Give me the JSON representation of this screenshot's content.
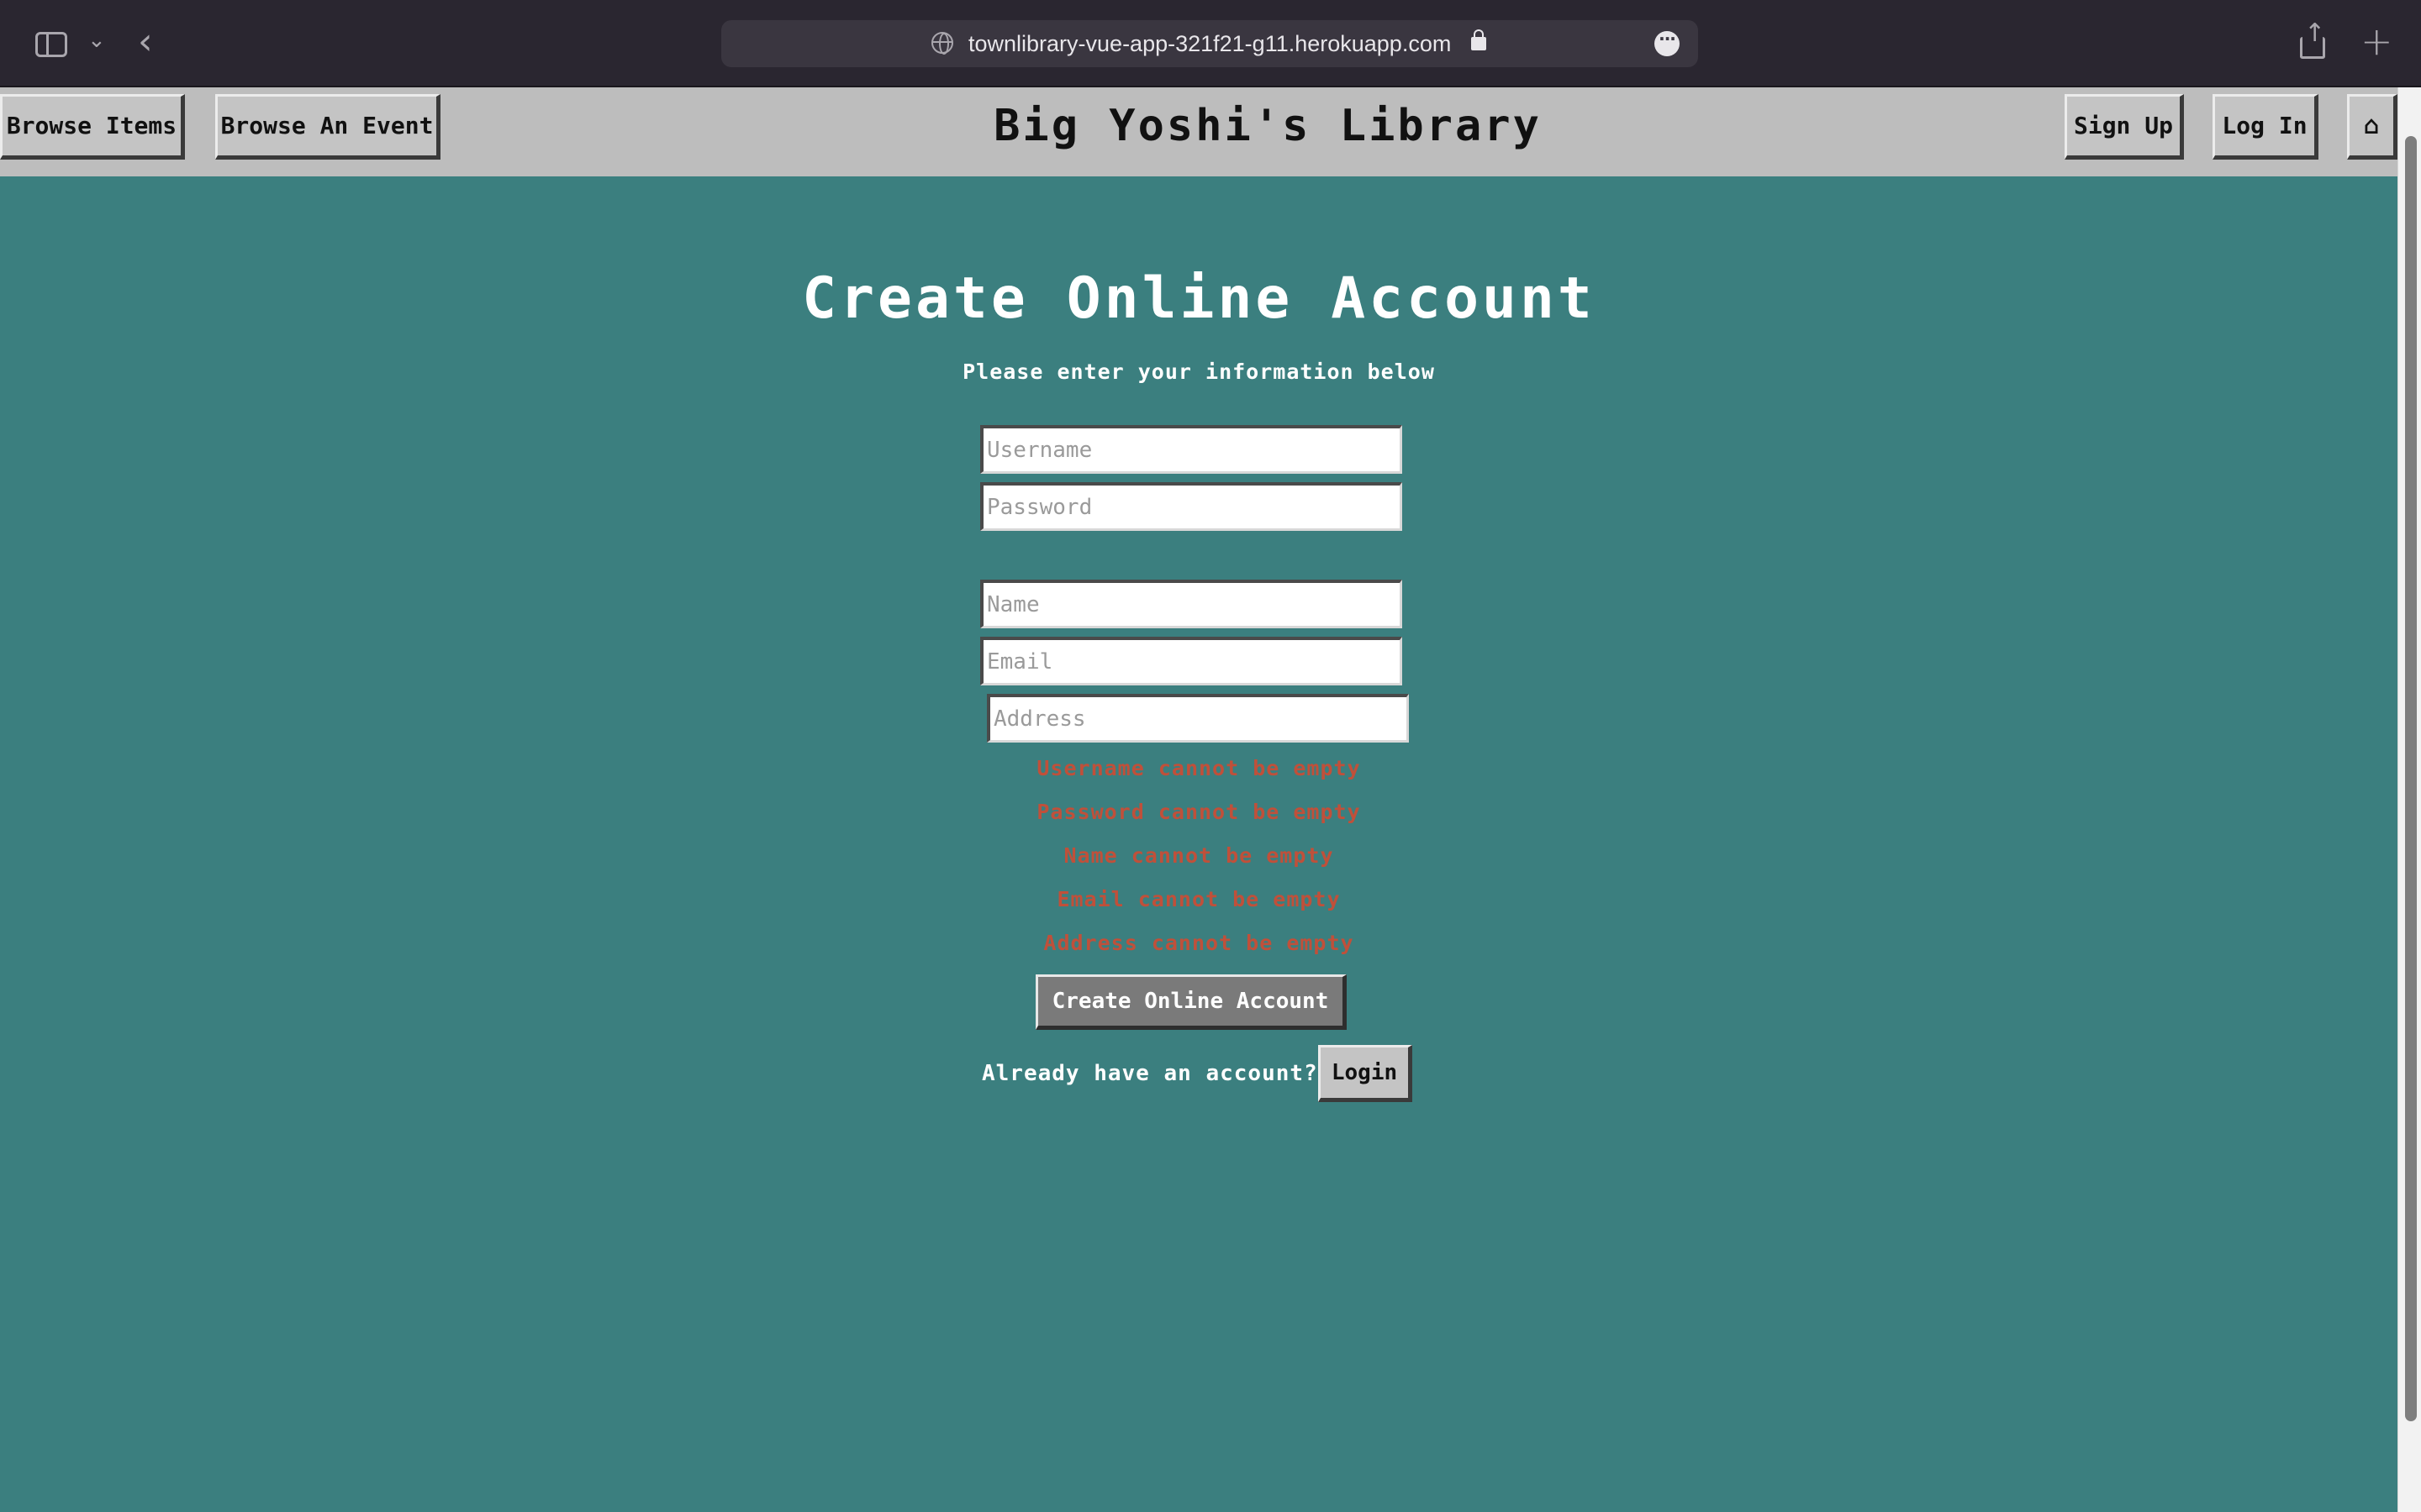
{
  "browser": {
    "url": "townlibrary-vue-app-321f21-g11.herokuapp.com",
    "icons": [
      "sidebar-icon",
      "chevron-down-icon",
      "back-arrow-icon",
      "globe-icon",
      "lock-icon",
      "more-icon",
      "share-icon",
      "plus-icon"
    ]
  },
  "header": {
    "title": "Big Yoshi's Library",
    "browse_items": "Browse Items",
    "browse_event": "Browse An Event",
    "sign_up": "Sign Up",
    "log_in": "Log In",
    "home_icon": "home-icon"
  },
  "form": {
    "title": "Create Online Account",
    "subtitle": "Please enter your information below",
    "fields": {
      "username": {
        "placeholder": "Username",
        "value": ""
      },
      "password": {
        "placeholder": "Password",
        "value": ""
      },
      "name": {
        "placeholder": "Name",
        "value": ""
      },
      "email": {
        "placeholder": "Email",
        "value": ""
      },
      "address": {
        "placeholder": "Address",
        "value": ""
      }
    },
    "errors": [
      "Username cannot be empty",
      "Password cannot be empty",
      "Name cannot be empty",
      "Email cannot be empty",
      "Address cannot be empty"
    ],
    "submit_label": "Create Online Account",
    "login_prompt": "Already have an account?",
    "login_label": "Login"
  },
  "colors": {
    "background": "#3b7f7f",
    "header": "#bdbdbd",
    "error": "#c0503a",
    "browser_chrome": "#2a2630"
  }
}
